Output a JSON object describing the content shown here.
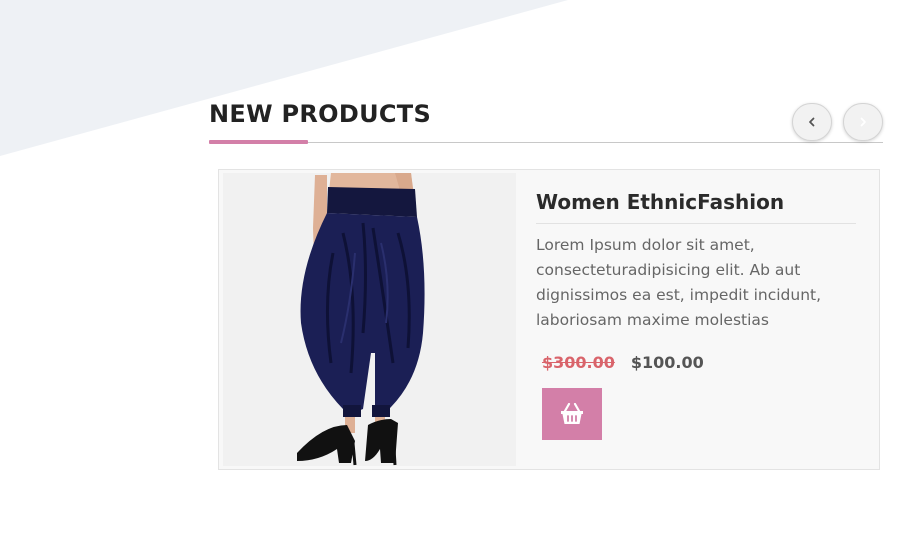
{
  "section": {
    "title": "NEW PRODUCTS",
    "accent_color": "#d37fa8",
    "nav": {
      "prev_icon": "chevron-left-icon",
      "next_icon": "chevron-right-icon"
    }
  },
  "product": {
    "name": "Women EthnicFashion",
    "description": "Lorem Ipsum dolor sit amet, consecteturadipisicing elit. Ab aut dignissimos ea est, impedit incidunt, laboriosam maxime molestias",
    "old_price": "$300.00",
    "new_price": "$100.00",
    "cart_icon": "basket-icon",
    "image": "navy-dhoti-pants"
  },
  "colors": {
    "accent": "#d37fa8",
    "old_price": "#d9646b",
    "background_shape": "#eef1f5"
  }
}
